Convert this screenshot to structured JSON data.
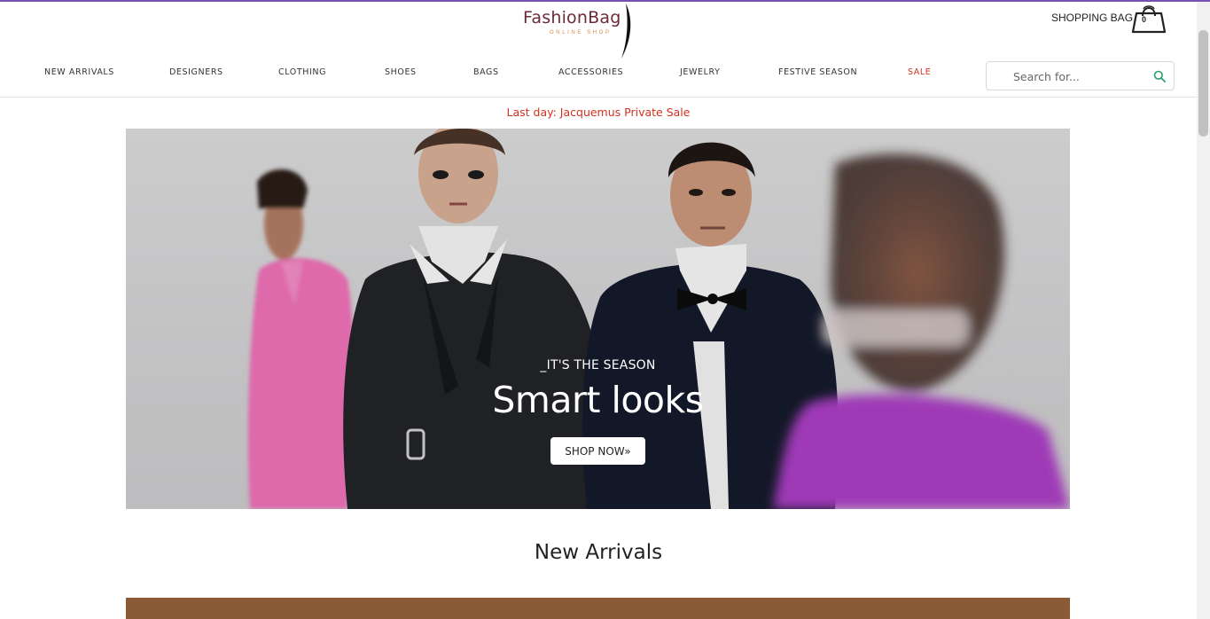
{
  "header": {
    "logo_text": "FashionBag",
    "logo_sub": "ONLINE SHOP",
    "bag_label": "SHOPPING BAG",
    "bag_count": "0"
  },
  "nav": {
    "items": [
      {
        "label": "NEW ARRIVALS"
      },
      {
        "label": "DESIGNERS"
      },
      {
        "label": "CLOTHING"
      },
      {
        "label": "SHOES"
      },
      {
        "label": "BAGS"
      },
      {
        "label": "ACCESSORIES"
      },
      {
        "label": "JEWELRY"
      },
      {
        "label": "FESTIVE SEASON"
      },
      {
        "label": "SALE"
      }
    ]
  },
  "search": {
    "placeholder": "Search for...",
    "icon": "search-icon"
  },
  "promo": {
    "text": "Last day: Jacquemus Private Sale"
  },
  "hero": {
    "kicker": "_IT'S THE SEASON",
    "title": "Smart looks",
    "button_label": "SHOP NOW»"
  },
  "new_arrivals": {
    "title": "New Arrivals"
  },
  "colors": {
    "accent_line": "#7a4fb5",
    "sale_red": "#d0321f",
    "logo": "#6b2a3a",
    "search_icon": "#2a9d6a"
  }
}
